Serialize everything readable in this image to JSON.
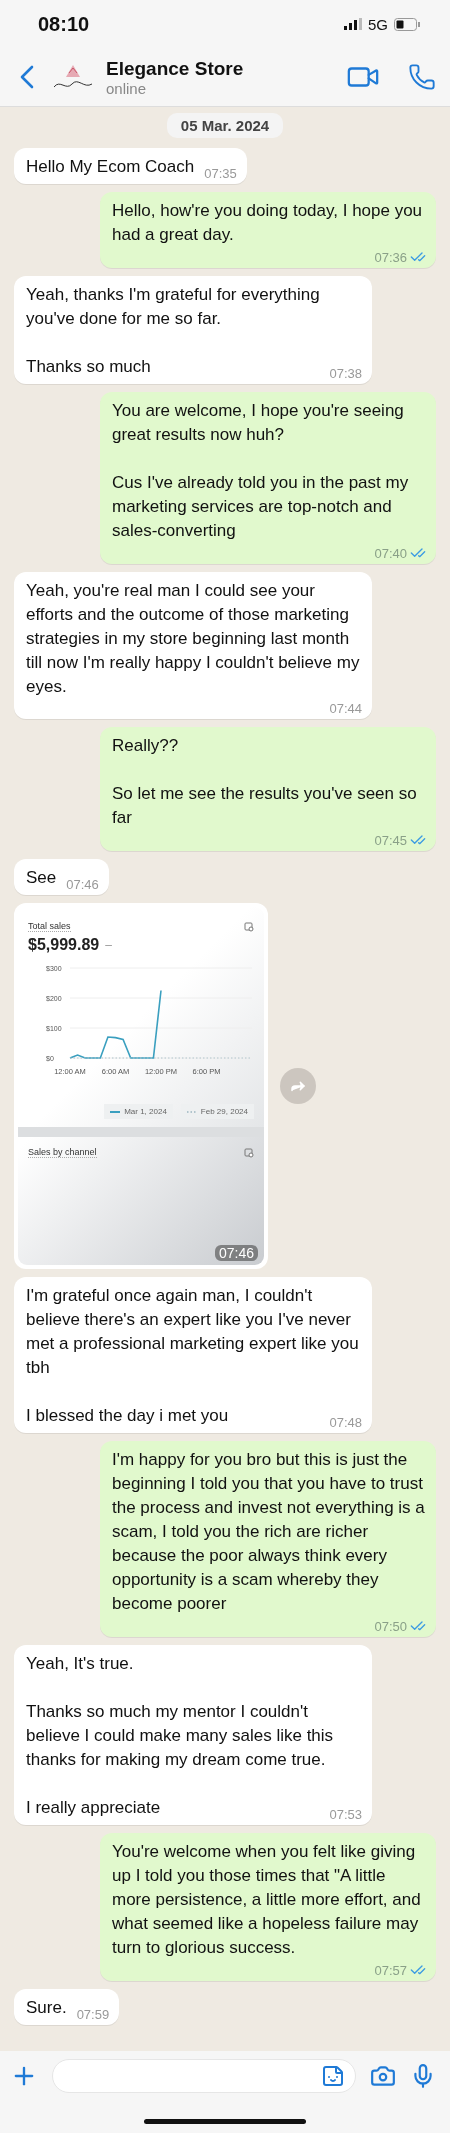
{
  "status_bar": {
    "time": "08:10",
    "network": "5G"
  },
  "header": {
    "name": "Elegance Store",
    "status": "online"
  },
  "date_chip": "05 Mar. 2024",
  "messages": [
    {
      "kind": "text",
      "outgoing": false,
      "paragraphs": [
        "Hello My Ecom Coach"
      ],
      "time": "07:35"
    },
    {
      "kind": "text",
      "outgoing": true,
      "read": true,
      "paragraphs": [
        "Hello, how're you doing today, I hope you had a great day."
      ],
      "time": "07:36"
    },
    {
      "kind": "text",
      "outgoing": false,
      "paragraphs": [
        "Yeah, thanks I'm grateful for everything you've done for me so far.",
        "Thanks so much"
      ],
      "time": "07:38"
    },
    {
      "kind": "text",
      "outgoing": true,
      "read": true,
      "paragraphs": [
        "You are welcome, I hope you're seeing great results now huh?",
        "Cus I've already told you in the past my marketing services are top-notch and sales-converting"
      ],
      "time": "07:40"
    },
    {
      "kind": "text",
      "outgoing": false,
      "paragraphs": [
        "Yeah, you're real man I could see your efforts and the outcome of those marketing strategies in my store beginning last month till now I'm really happy I couldn't believe my eyes."
      ],
      "time": "07:44"
    },
    {
      "kind": "text",
      "outgoing": true,
      "read": true,
      "paragraphs": [
        "Really??",
        "So let me see the results you've seen so far"
      ],
      "time": "07:45"
    },
    {
      "kind": "text",
      "outgoing": false,
      "paragraphs": [
        "See"
      ],
      "time": "07:46"
    },
    {
      "kind": "image",
      "outgoing": false,
      "time": "07:46",
      "screenshot": {
        "title": "Total sales",
        "total": "$5,999.89",
        "total_suffix": "–",
        "section_2": "Sales by channel",
        "chart_data": {
          "type": "line",
          "x": [
            0,
            1,
            2,
            3,
            4,
            5,
            6,
            7,
            8,
            9,
            10,
            11,
            12,
            13,
            14,
            15,
            16,
            17,
            18,
            19,
            20,
            21,
            22,
            23,
            24
          ],
          "xticks": [
            {
              "value": 0,
              "label": "12:00 AM"
            },
            {
              "value": 6,
              "label": "6:00 AM"
            },
            {
              "value": 12,
              "label": "12:00 PM"
            },
            {
              "value": 18,
              "label": "6:00 PM"
            }
          ],
          "yticks": [
            {
              "value": 0,
              "label": "$0"
            },
            {
              "value": 100,
              "label": "$100"
            },
            {
              "value": 200,
              "label": "$200"
            },
            {
              "value": 300,
              "label": "$300"
            }
          ],
          "ylim": [
            0,
            300
          ],
          "xlim": [
            0,
            24
          ],
          "series": [
            {
              "name": "Mar 1, 2024",
              "color": "#3a9fbf",
              "line_style": "solid",
              "values": [
                0,
                10,
                0,
                0,
                0,
                70,
                68,
                62,
                0,
                0,
                0,
                0,
                225,
                null,
                null,
                null,
                null,
                null,
                null,
                null,
                null,
                null,
                null,
                null,
                null
              ]
            },
            {
              "name": "Feb 29, 2024",
              "color": "#b0c4cc",
              "line_style": "dotted",
              "values": [
                0,
                0,
                0,
                0,
                0,
                0,
                0,
                0,
                0,
                0,
                0,
                0,
                0,
                0,
                0,
                0,
                0,
                0,
                0,
                0,
                0,
                0,
                0,
                0,
                0
              ]
            }
          ]
        }
      }
    },
    {
      "kind": "text",
      "outgoing": false,
      "paragraphs": [
        "I'm grateful once again man, I couldn't believe there's an expert like you I've never met a professional marketing expert like you tbh",
        "I blessed the day i met you"
      ],
      "time": "07:48"
    },
    {
      "kind": "text",
      "outgoing": true,
      "read": true,
      "paragraphs": [
        "I'm happy for you bro but this is just the beginning I told you that you have to trust the process and invest not everything is a scam, I told you the rich are richer because the poor always think every opportunity is a scam whereby they become poorer"
      ],
      "time": "07:50"
    },
    {
      "kind": "text",
      "outgoing": false,
      "paragraphs": [
        "Yeah, It's true.",
        "Thanks so much my mentor I couldn't believe I could make many sales like this thanks for making my dream come true.",
        "I really appreciate"
      ],
      "time": "07:53"
    },
    {
      "kind": "text",
      "outgoing": true,
      "read": true,
      "paragraphs": [
        "You're welcome when you felt like giving up I told you those times that \"A little more persistence, a little more effort, and what seemed like a hopeless failure may turn to glorious success."
      ],
      "time": "07:57"
    },
    {
      "kind": "text",
      "outgoing": false,
      "paragraphs": [
        "Sure."
      ],
      "time": "07:59"
    }
  ]
}
